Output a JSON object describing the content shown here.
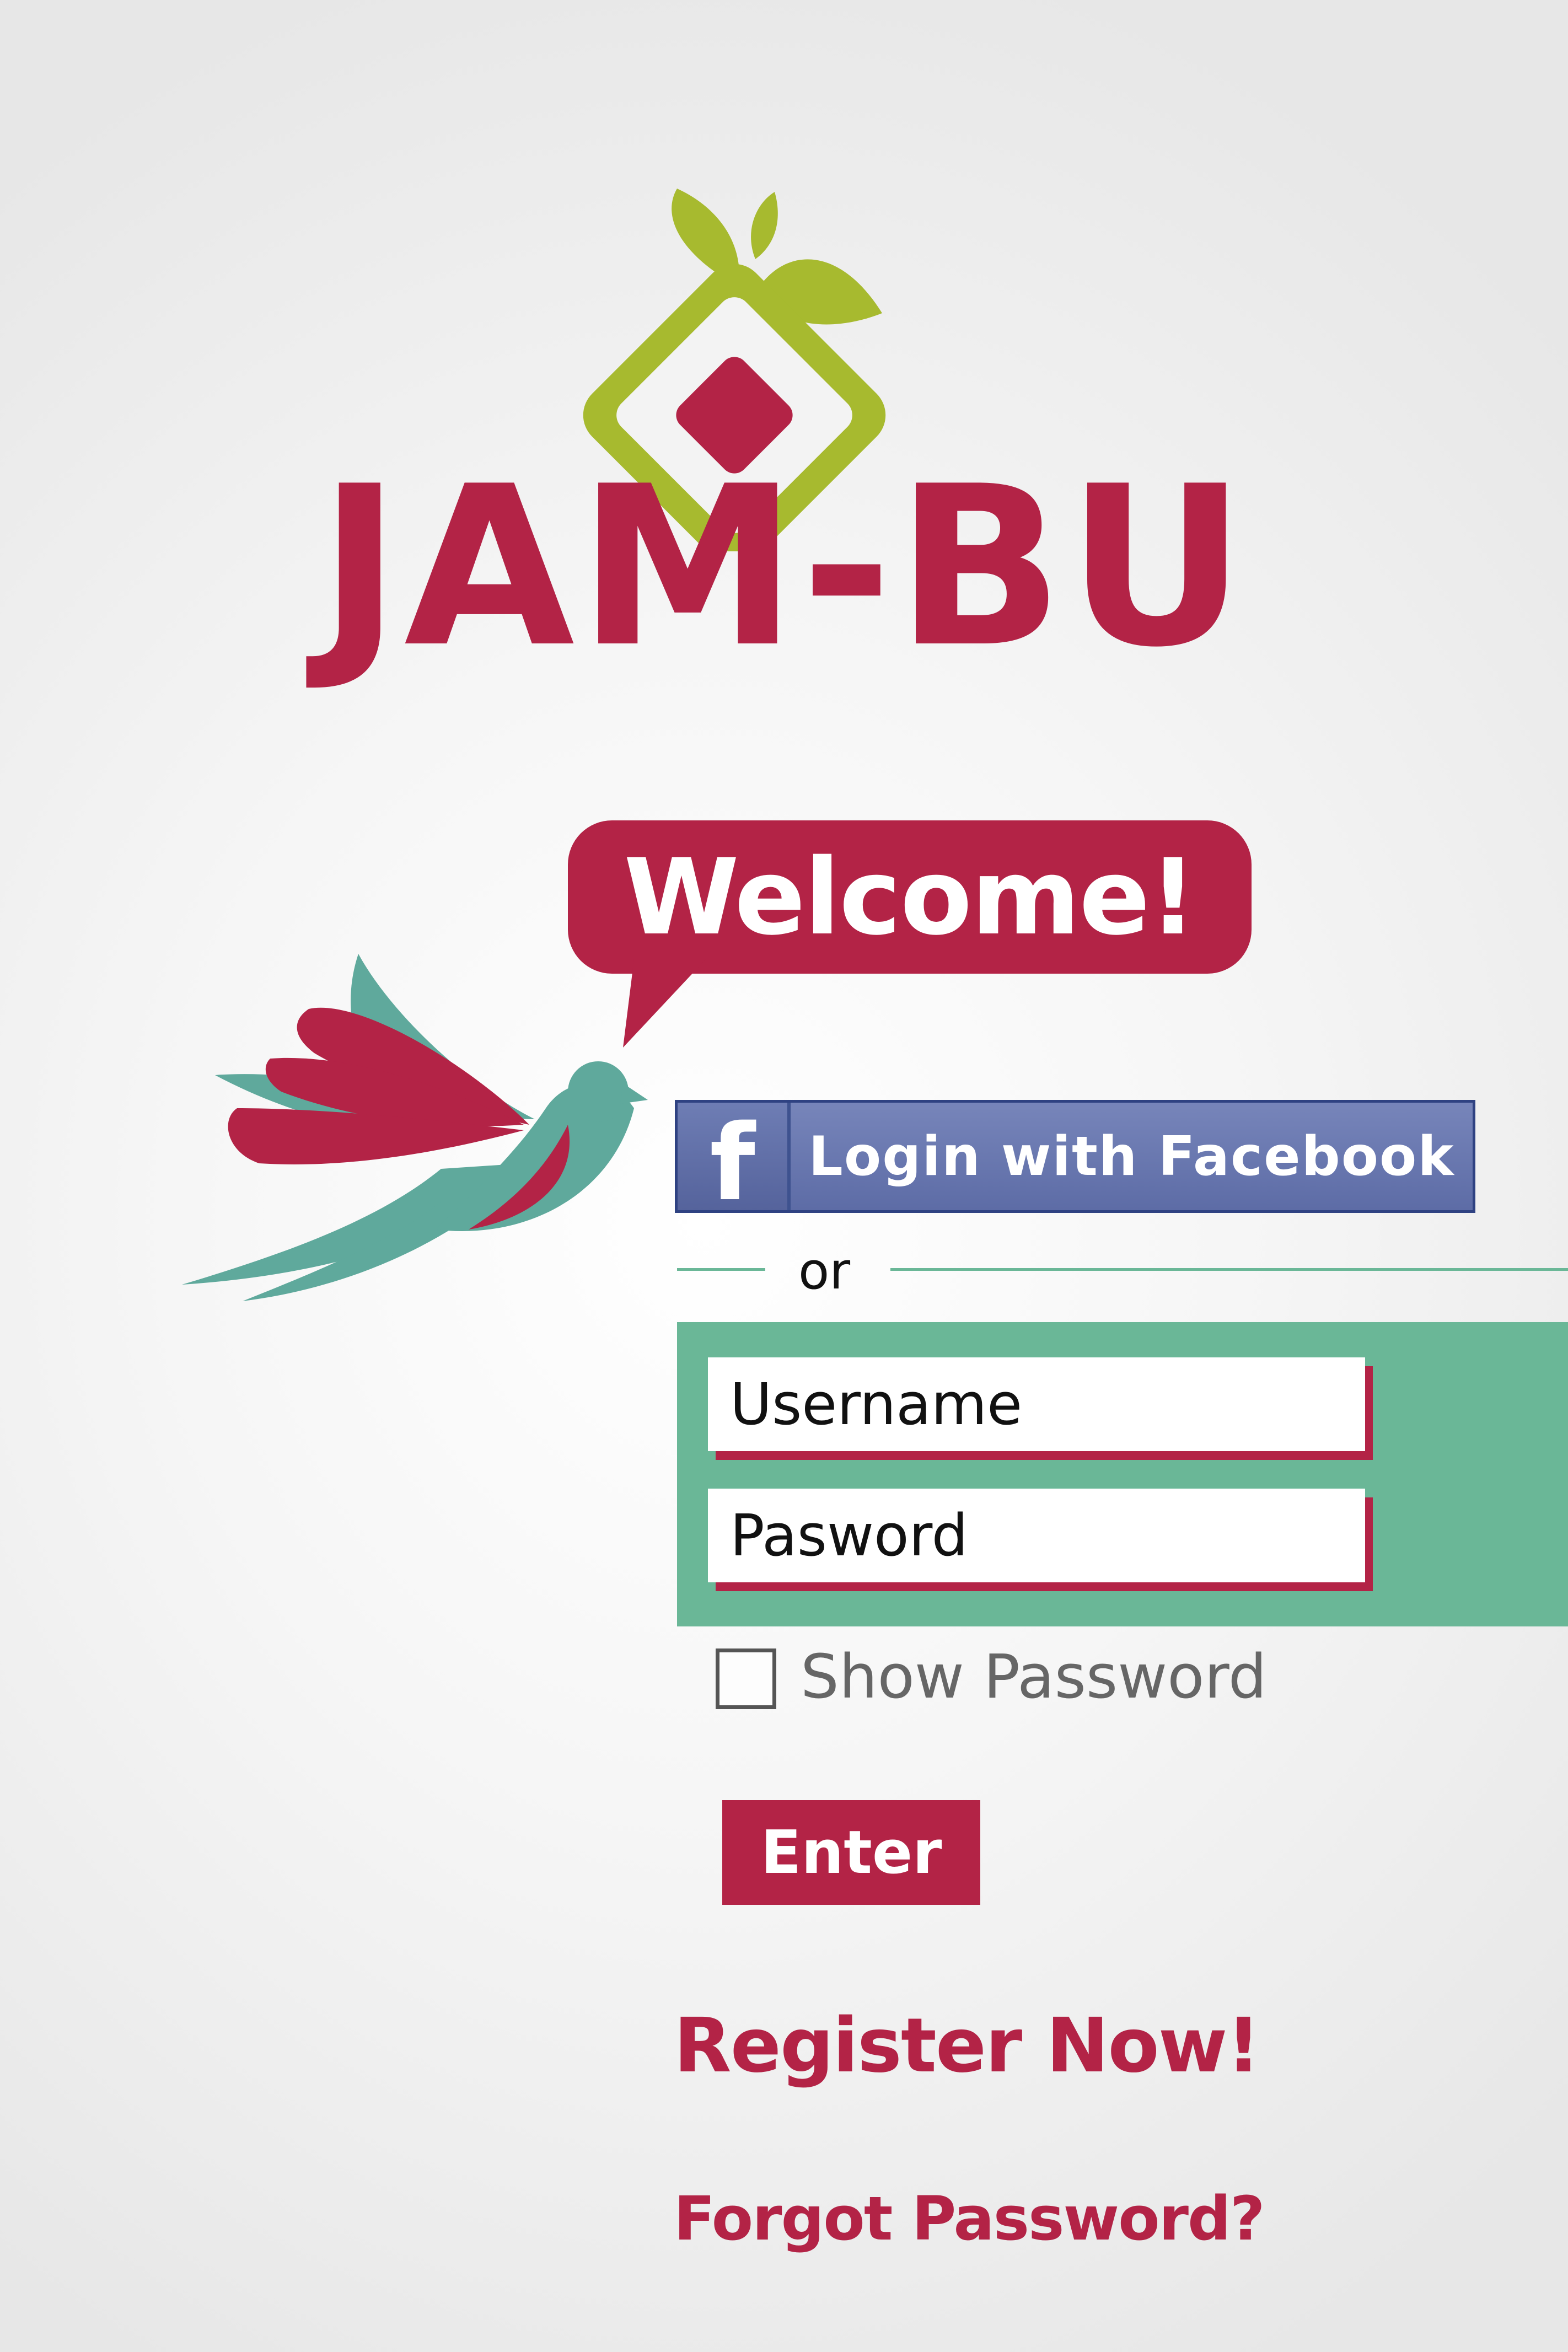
{
  "brand": {
    "name": "JAM-BU",
    "welcome": "Welcome!",
    "colors": {
      "primary": "#b32346",
      "leaf": "#a7ba2f",
      "teal": "#5fa99c",
      "panel": "#6ab797"
    }
  },
  "facebook": {
    "icon": "f",
    "label": "Login with Facebook",
    "color": "#5d6ca6"
  },
  "divider": {
    "label": "or"
  },
  "login": {
    "username_placeholder": "Username",
    "password_placeholder": "Pasword",
    "show_password_label": "Show Password",
    "show_password_checked": false,
    "enter_label": "Enter"
  },
  "links": {
    "register": "Register Now!",
    "forgot_password": "Forgot Password?"
  },
  "icons": {
    "logo": "leaf-diamond-logo-icon",
    "bird": "bird-icon",
    "facebook": "facebook-icon"
  }
}
